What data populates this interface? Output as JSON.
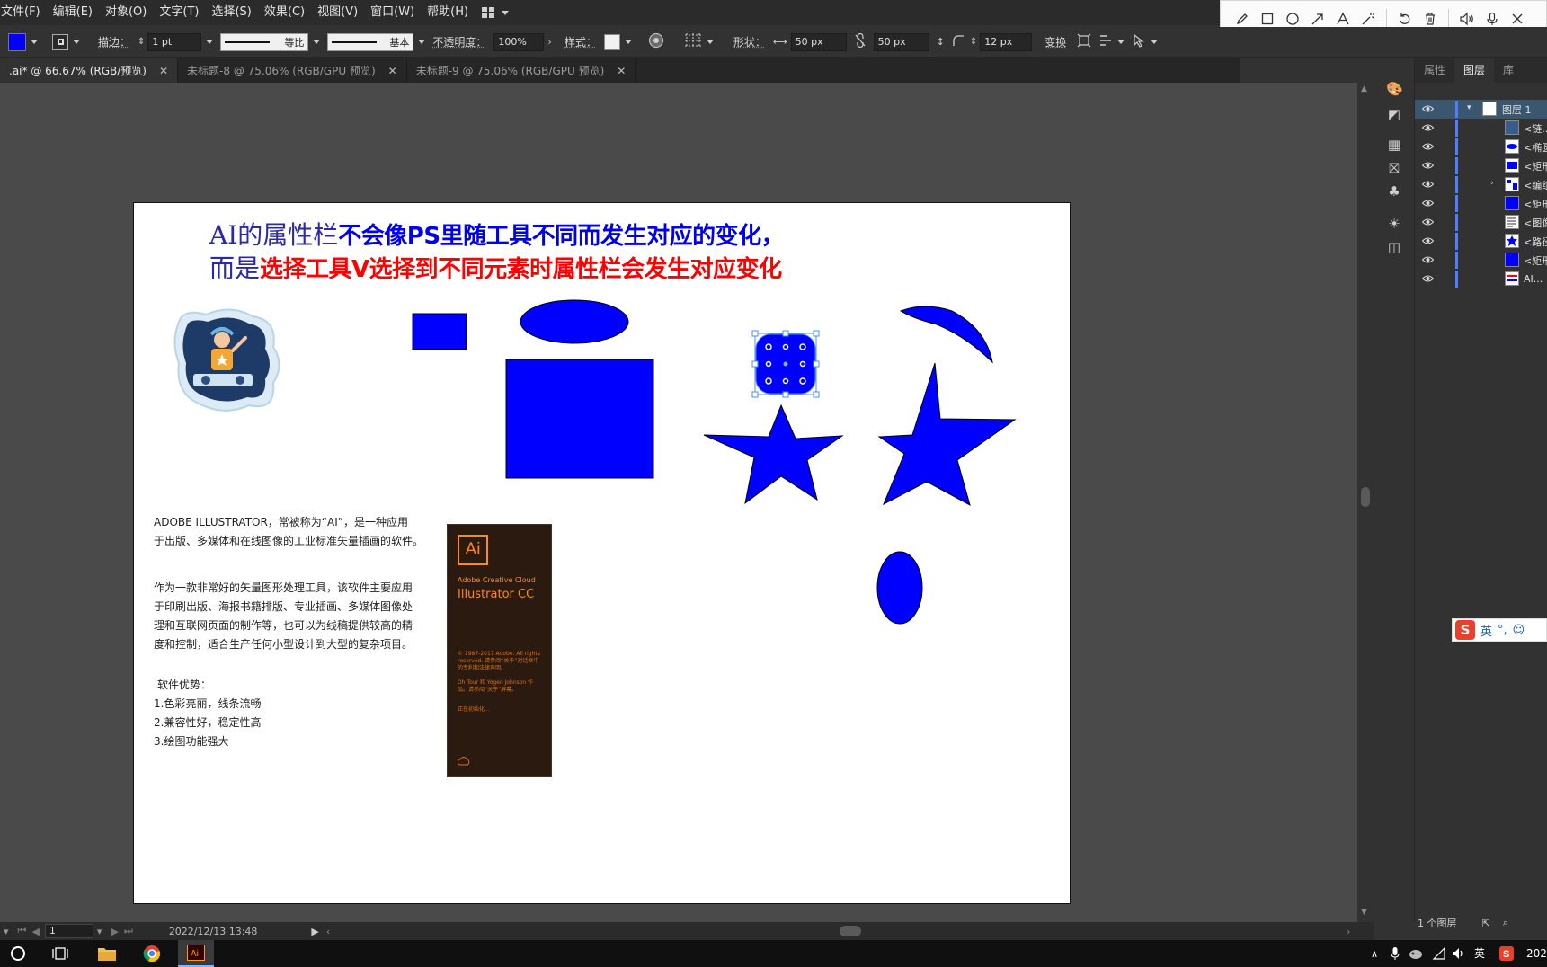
{
  "menubar": {
    "items": [
      "文件(F)",
      "编辑(E)",
      "对象(O)",
      "文字(T)",
      "选择(S)",
      "效果(C)",
      "视图(V)",
      "窗口(W)",
      "帮助(H)"
    ]
  },
  "controlbar": {
    "stroke_label": "描边：",
    "stroke_weight": "1 pt",
    "stroke_profile": "等比",
    "brush_label": "基本",
    "opacity_label": "不透明度：",
    "opacity_value": "100%",
    "style_label": "样式：",
    "shape_label": "形状：",
    "width_value": "50 px",
    "height_value": "50 px",
    "corner_value": "12 px",
    "transform_label": "变换",
    "fill_color": "#0000ff"
  },
  "tabs": [
    {
      "label": ".ai* @ 66.67% (RGB/预览)",
      "active": true
    },
    {
      "label": "未标题-8 @ 75.06% (RGB/GPU 预览)",
      "active": false
    },
    {
      "label": "未标题-9 @ 75.06% (RGB/GPU 预览)",
      "active": false
    }
  ],
  "artboard": {
    "headline_line1_thin": "AI的属性栏",
    "headline_line1_bold": "不会像PS里随工具不同而发生对应的变化，",
    "headline_line2_thin": "而是",
    "headline_line2_bold": "选择工具V选择到不同元素时属性栏会发生对应变化",
    "para1": [
      "ADOBE ILLUSTRATOR，常被称为“AI”，是一种应用",
      "于出版、多媒体和在线图像的工业标准矢量插画的软件。"
    ],
    "para2": [
      "作为一款非常好的矢量图形处理工具，该软件主要应用",
      "于印刷出版、海报书籍排版、专业插画、多媒体图像处",
      "理和互联网页面的制作等，也可以为线稿提供较高的精",
      "度和控制，适合生产任何小型设计到大型的复杂项目。"
    ],
    "advantages_title": "软件优势：",
    "advantages": [
      "1.色彩亮丽，线条流畅",
      "2.兼容性好，稳定性高",
      "3.绘图功能强大"
    ],
    "shape_color": "#0000ff",
    "splash": {
      "logo": "Ai",
      "brand": "Adobe Creative Cloud",
      "product": "Illustrator CC",
      "copyright": "© 1987-2017 Adobe. All rights reserved. 请参阅“关于”对话框中的专利和法律声明。",
      "credits": "Oh Tour 和 Yogen Johnson 作品。请参阅“关于”屏幕。",
      "status": "正在初始化..."
    }
  },
  "panel": {
    "tabs": [
      "属性",
      "图层",
      "库"
    ],
    "active_tab": "图层",
    "top_layer": "图层 1",
    "layers": [
      "<链...",
      "<椭圆...",
      "<矩形...",
      "<编组...",
      "<矩形...",
      "<图像...",
      "<路径...",
      "<矩形...",
      "AI..."
    ],
    "footer": "1 个图层"
  },
  "statusbar": {
    "zoom": "1",
    "datetime": "2022/12/13  13:48"
  },
  "ime": {
    "logo": "S",
    "lang": "英"
  },
  "taskbar": {
    "ime_lang": "英",
    "clock": "202"
  },
  "icons": [
    "pencil-icon",
    "rectangle-icon",
    "circle-icon",
    "arrow-icon",
    "text-icon",
    "magic-wand-icon",
    "undo-icon",
    "trash-icon",
    "speaker-icon",
    "microphone-icon",
    "close-icon"
  ]
}
